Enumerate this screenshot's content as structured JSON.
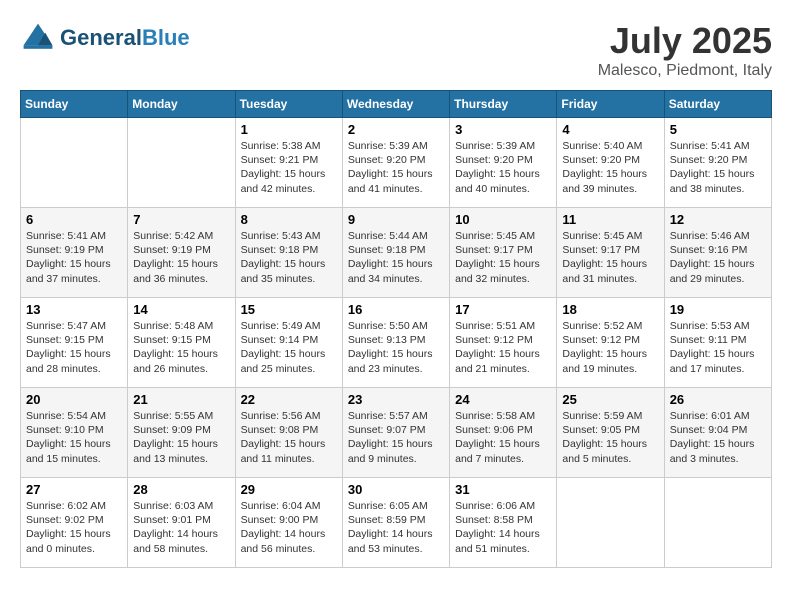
{
  "header": {
    "logo_line1": "General",
    "logo_line2": "Blue",
    "month": "July 2025",
    "location": "Malesco, Piedmont, Italy"
  },
  "weekdays": [
    "Sunday",
    "Monday",
    "Tuesday",
    "Wednesday",
    "Thursday",
    "Friday",
    "Saturday"
  ],
  "weeks": [
    [
      {
        "day": "",
        "info": ""
      },
      {
        "day": "",
        "info": ""
      },
      {
        "day": "1",
        "info": "Sunrise: 5:38 AM\nSunset: 9:21 PM\nDaylight: 15 hours\nand 42 minutes."
      },
      {
        "day": "2",
        "info": "Sunrise: 5:39 AM\nSunset: 9:20 PM\nDaylight: 15 hours\nand 41 minutes."
      },
      {
        "day": "3",
        "info": "Sunrise: 5:39 AM\nSunset: 9:20 PM\nDaylight: 15 hours\nand 40 minutes."
      },
      {
        "day": "4",
        "info": "Sunrise: 5:40 AM\nSunset: 9:20 PM\nDaylight: 15 hours\nand 39 minutes."
      },
      {
        "day": "5",
        "info": "Sunrise: 5:41 AM\nSunset: 9:20 PM\nDaylight: 15 hours\nand 38 minutes."
      }
    ],
    [
      {
        "day": "6",
        "info": "Sunrise: 5:41 AM\nSunset: 9:19 PM\nDaylight: 15 hours\nand 37 minutes."
      },
      {
        "day": "7",
        "info": "Sunrise: 5:42 AM\nSunset: 9:19 PM\nDaylight: 15 hours\nand 36 minutes."
      },
      {
        "day": "8",
        "info": "Sunrise: 5:43 AM\nSunset: 9:18 PM\nDaylight: 15 hours\nand 35 minutes."
      },
      {
        "day": "9",
        "info": "Sunrise: 5:44 AM\nSunset: 9:18 PM\nDaylight: 15 hours\nand 34 minutes."
      },
      {
        "day": "10",
        "info": "Sunrise: 5:45 AM\nSunset: 9:17 PM\nDaylight: 15 hours\nand 32 minutes."
      },
      {
        "day": "11",
        "info": "Sunrise: 5:45 AM\nSunset: 9:17 PM\nDaylight: 15 hours\nand 31 minutes."
      },
      {
        "day": "12",
        "info": "Sunrise: 5:46 AM\nSunset: 9:16 PM\nDaylight: 15 hours\nand 29 minutes."
      }
    ],
    [
      {
        "day": "13",
        "info": "Sunrise: 5:47 AM\nSunset: 9:15 PM\nDaylight: 15 hours\nand 28 minutes."
      },
      {
        "day": "14",
        "info": "Sunrise: 5:48 AM\nSunset: 9:15 PM\nDaylight: 15 hours\nand 26 minutes."
      },
      {
        "day": "15",
        "info": "Sunrise: 5:49 AM\nSunset: 9:14 PM\nDaylight: 15 hours\nand 25 minutes."
      },
      {
        "day": "16",
        "info": "Sunrise: 5:50 AM\nSunset: 9:13 PM\nDaylight: 15 hours\nand 23 minutes."
      },
      {
        "day": "17",
        "info": "Sunrise: 5:51 AM\nSunset: 9:12 PM\nDaylight: 15 hours\nand 21 minutes."
      },
      {
        "day": "18",
        "info": "Sunrise: 5:52 AM\nSunset: 9:12 PM\nDaylight: 15 hours\nand 19 minutes."
      },
      {
        "day": "19",
        "info": "Sunrise: 5:53 AM\nSunset: 9:11 PM\nDaylight: 15 hours\nand 17 minutes."
      }
    ],
    [
      {
        "day": "20",
        "info": "Sunrise: 5:54 AM\nSunset: 9:10 PM\nDaylight: 15 hours\nand 15 minutes."
      },
      {
        "day": "21",
        "info": "Sunrise: 5:55 AM\nSunset: 9:09 PM\nDaylight: 15 hours\nand 13 minutes."
      },
      {
        "day": "22",
        "info": "Sunrise: 5:56 AM\nSunset: 9:08 PM\nDaylight: 15 hours\nand 11 minutes."
      },
      {
        "day": "23",
        "info": "Sunrise: 5:57 AM\nSunset: 9:07 PM\nDaylight: 15 hours\nand 9 minutes."
      },
      {
        "day": "24",
        "info": "Sunrise: 5:58 AM\nSunset: 9:06 PM\nDaylight: 15 hours\nand 7 minutes."
      },
      {
        "day": "25",
        "info": "Sunrise: 5:59 AM\nSunset: 9:05 PM\nDaylight: 15 hours\nand 5 minutes."
      },
      {
        "day": "26",
        "info": "Sunrise: 6:01 AM\nSunset: 9:04 PM\nDaylight: 15 hours\nand 3 minutes."
      }
    ],
    [
      {
        "day": "27",
        "info": "Sunrise: 6:02 AM\nSunset: 9:02 PM\nDaylight: 15 hours\nand 0 minutes."
      },
      {
        "day": "28",
        "info": "Sunrise: 6:03 AM\nSunset: 9:01 PM\nDaylight: 14 hours\nand 58 minutes."
      },
      {
        "day": "29",
        "info": "Sunrise: 6:04 AM\nSunset: 9:00 PM\nDaylight: 14 hours\nand 56 minutes."
      },
      {
        "day": "30",
        "info": "Sunrise: 6:05 AM\nSunset: 8:59 PM\nDaylight: 14 hours\nand 53 minutes."
      },
      {
        "day": "31",
        "info": "Sunrise: 6:06 AM\nSunset: 8:58 PM\nDaylight: 14 hours\nand 51 minutes."
      },
      {
        "day": "",
        "info": ""
      },
      {
        "day": "",
        "info": ""
      }
    ]
  ]
}
